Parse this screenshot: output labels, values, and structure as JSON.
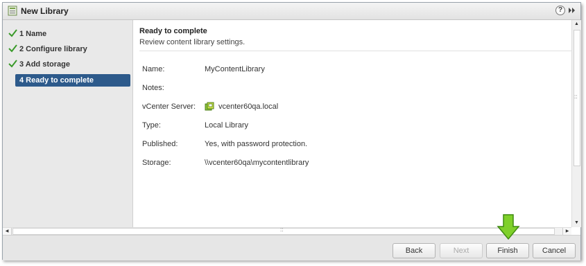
{
  "window": {
    "title": "New Library",
    "help_icon": "?"
  },
  "sidebar": {
    "steps": [
      {
        "label": "1  Name",
        "status": "done"
      },
      {
        "label": "2  Configure library",
        "status": "done"
      },
      {
        "label": "3  Add storage",
        "status": "done"
      },
      {
        "label": "4  Ready to complete",
        "status": "active"
      }
    ]
  },
  "content": {
    "title": "Ready to complete",
    "subtitle": "Review content library settings.",
    "fields": [
      {
        "label": "Name:",
        "value": "MyContentLibrary"
      },
      {
        "label": "Notes:",
        "value": ""
      },
      {
        "label": "vCenter Server:",
        "value": "vcenter60qa.local",
        "icon": "vcenter-icon"
      },
      {
        "label": "Type:",
        "value": "Local Library"
      },
      {
        "label": "Published:",
        "value": "Yes, with password protection."
      },
      {
        "label": "Storage:",
        "value": "\\\\vcenter60qa\\mycontentlibrary"
      }
    ]
  },
  "footer": {
    "back_label": "Back",
    "next_label": "Next",
    "finish_label": "Finish",
    "cancel_label": "Cancel"
  },
  "colors": {
    "active_step": "#2d5a8b",
    "check": "#3a9a2a",
    "arrow": "#7fd02a"
  }
}
